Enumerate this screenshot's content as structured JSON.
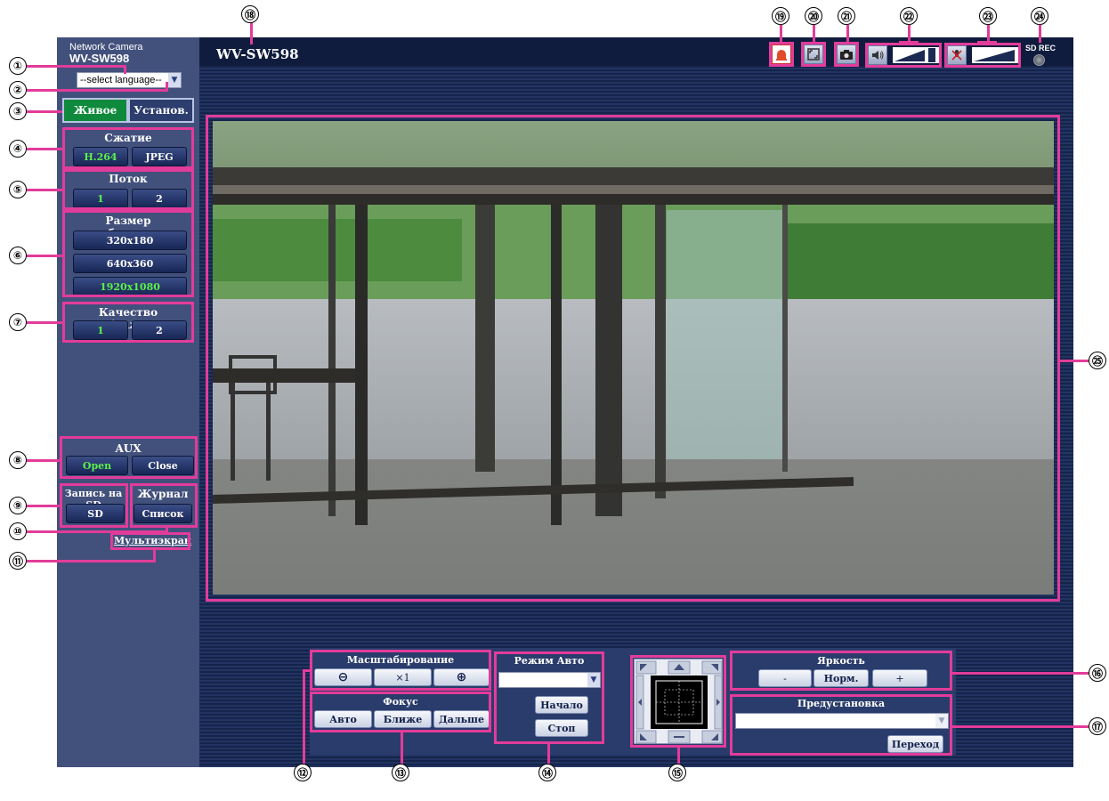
{
  "header": {
    "product_line": "Network Camera",
    "model_top": "WV-SW598",
    "model_title": "WV-SW598",
    "sd_rec_label": "SD REC"
  },
  "language_select": {
    "value": "--select language--"
  },
  "tabs": {
    "live": "Живое",
    "setup": "Установ."
  },
  "compression": {
    "title": "Сжатие",
    "options": [
      "H.264",
      "JPEG"
    ],
    "active": "H.264"
  },
  "stream": {
    "title": "Поток",
    "options": [
      "1",
      "2"
    ],
    "active": "1"
  },
  "image_size": {
    "title": "Размер изображения",
    "options": [
      "320x180",
      "640x360",
      "1920x1080"
    ],
    "active": "1920x1080"
  },
  "image_quality": {
    "title": "Качество изображения",
    "options": [
      "1",
      "2"
    ],
    "active": "1"
  },
  "aux": {
    "title": "AUX",
    "open": "Open",
    "close": "Close"
  },
  "sd_record": {
    "title": "Запись на SD",
    "button": "SD"
  },
  "log": {
    "title": "Журнал",
    "button": "Список"
  },
  "multiscreen_link": "Мультиэкран",
  "zoom": {
    "title": "Масштабирование",
    "reset": "×1"
  },
  "focus": {
    "title": "Фокус",
    "auto": "Авто",
    "near": "Ближе",
    "far": "Дальше"
  },
  "auto_mode": {
    "title": "Режим Авто",
    "select_value": "",
    "start": "Начало",
    "stop": "Стоп"
  },
  "brightness": {
    "title": "Яркость",
    "minus": "-",
    "normal": "Норм.",
    "plus": "+"
  },
  "preset": {
    "title": "Предустановка",
    "select_value": "",
    "go": "Переход"
  },
  "callouts": [
    "①",
    "②",
    "③",
    "④",
    "⑤",
    "⑥",
    "⑦",
    "⑧",
    "⑨",
    "⑩",
    "⑪",
    "⑫",
    "⑬",
    "⑭",
    "⑮",
    "⑯",
    "⑰",
    "⑱",
    "⑲",
    "⑳",
    "㉑",
    "㉒",
    "㉓",
    "㉔",
    "㉕"
  ],
  "colors": {
    "highlight": "#e23c9a",
    "active_text": "#5cf04c",
    "sidebar": "#42507c",
    "stage": "#1b2a52"
  },
  "icons": [
    "alarm-icon",
    "fullscreen-icon",
    "camera-snapshot-icon",
    "speaker-icon",
    "mic-mute-icon",
    "sd-led-icon"
  ]
}
